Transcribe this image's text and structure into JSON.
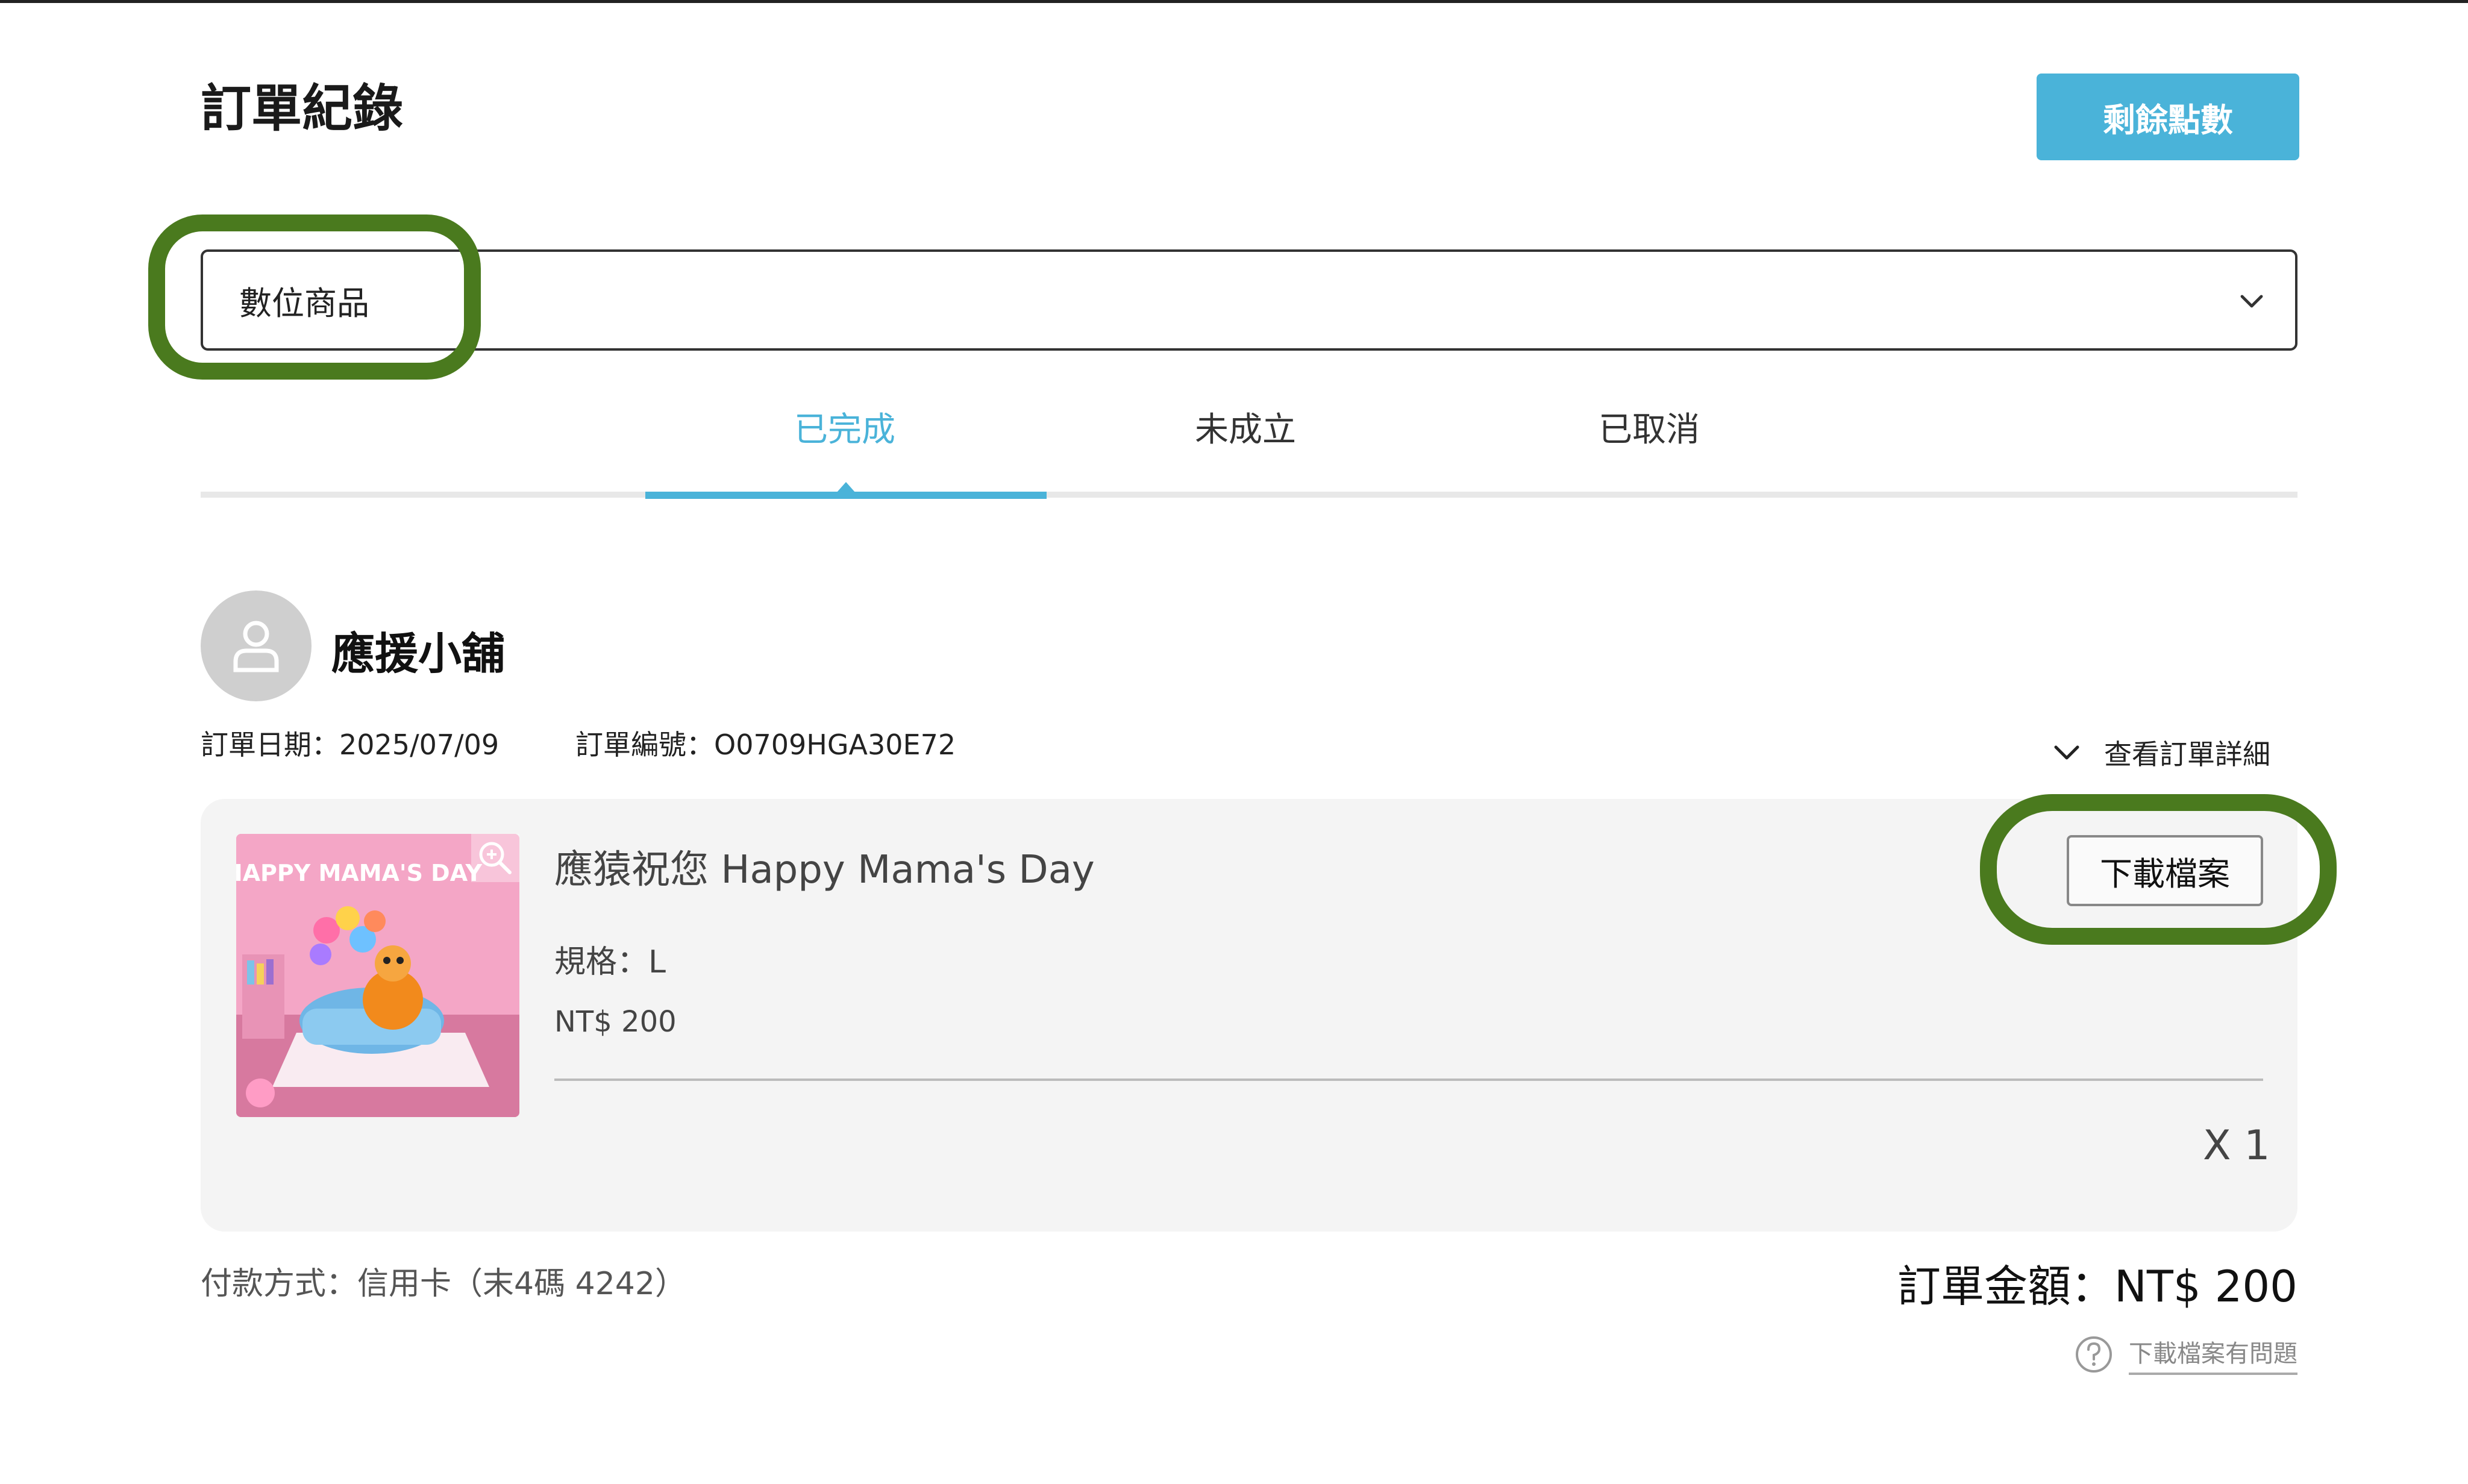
{
  "page": {
    "title": "訂單紀錄",
    "points_button_label": "剩餘點數"
  },
  "filter": {
    "selected": "數位商品"
  },
  "tabs": [
    {
      "label": "已完成",
      "active": true
    },
    {
      "label": "未成立",
      "active": false
    },
    {
      "label": "已取消",
      "active": false
    }
  ],
  "order": {
    "store_name": "應援小舖",
    "date_text": "訂單日期：2025/07/09",
    "number_text": "訂單編號：O0709HGA30E72",
    "details_label": "查看訂單詳細",
    "item": {
      "title": "應猿祝您 Happy Mama's Day",
      "spec": "規格：L",
      "price": "NT$ 200",
      "quantity": "X 1",
      "download_label": "下載檔案",
      "image_text": "HAPPY MAMA'S DAY"
    },
    "payment_text": "付款方式：信用卡（末4碼 4242）",
    "total_text": "訂單金額：NT$ 200",
    "help_label": "下載檔案有問題"
  },
  "colors": {
    "accent": "#4ab3d9",
    "highlight": "#4a7a1e"
  }
}
